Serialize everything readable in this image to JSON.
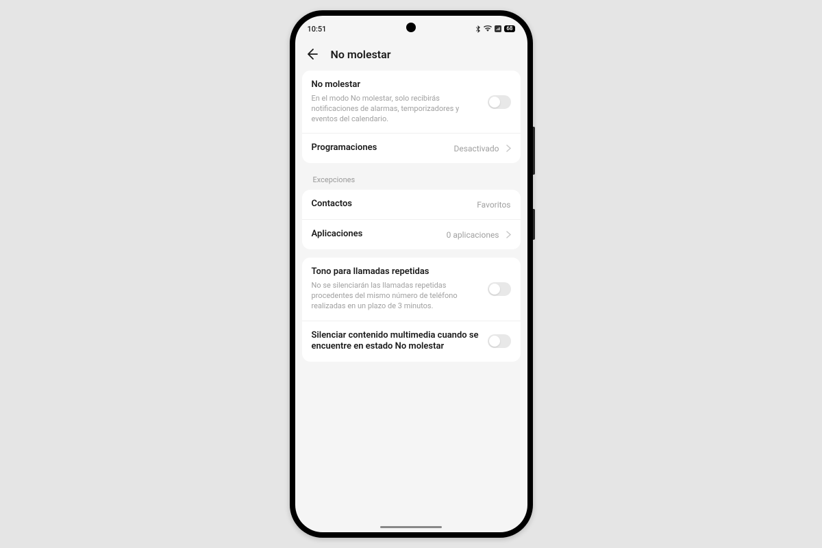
{
  "status": {
    "time": "10:51",
    "battery": "68"
  },
  "header": {
    "title": "No molestar"
  },
  "card1": {
    "dnd": {
      "title": "No molestar",
      "desc": "En el modo No molestar, solo recibirás notificaciones de alarmas, temporizadores y eventos del calendario."
    },
    "schedules": {
      "title": "Programaciones",
      "value": "Desactivado"
    }
  },
  "exceptions": {
    "label": "Excepciones",
    "contacts": {
      "title": "Contactos",
      "value": "Favoritos"
    },
    "apps": {
      "title": "Aplicaciones",
      "value": "0 aplicaciones"
    }
  },
  "card3": {
    "repeat": {
      "title": "Tono para llamadas repetidas",
      "desc": "No se silenciarán las llamadas repetidas procedentes del mismo número de teléfono realizadas en un plazo de 3 minutos."
    },
    "mute_media": {
      "title": "Silenciar contenido multimedia cuando se encuentre en estado No molestar"
    }
  }
}
